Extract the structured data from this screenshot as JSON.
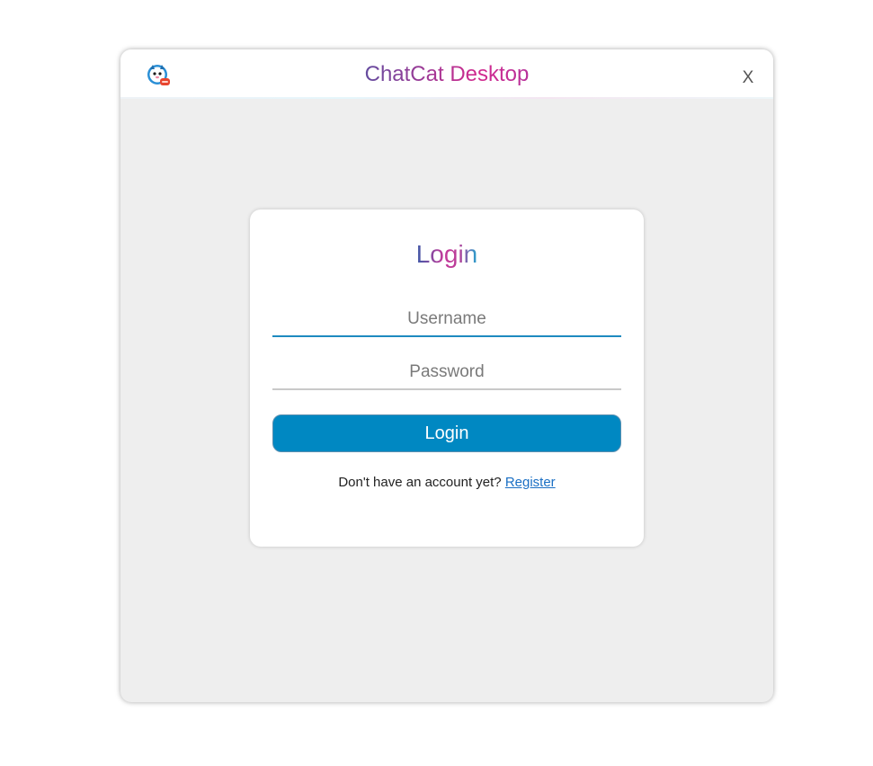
{
  "window": {
    "title_part1": "ChatCat",
    "title_part2": "Desktop",
    "close_label": "X"
  },
  "login": {
    "heading": "Login",
    "username_placeholder": "Username",
    "username_value": "",
    "password_placeholder": "Password",
    "password_value": "",
    "submit_label": "Login",
    "register_prompt": "Don't have an account yet?",
    "register_link": "Register"
  },
  "icons": {
    "app": "cat-mascot-icon",
    "close": "close-icon"
  },
  "colors": {
    "primary_button": "#0088c2",
    "focused_underline": "#1e8ac0",
    "link": "#1a6fc4",
    "window_bg": "#eeeeee"
  }
}
